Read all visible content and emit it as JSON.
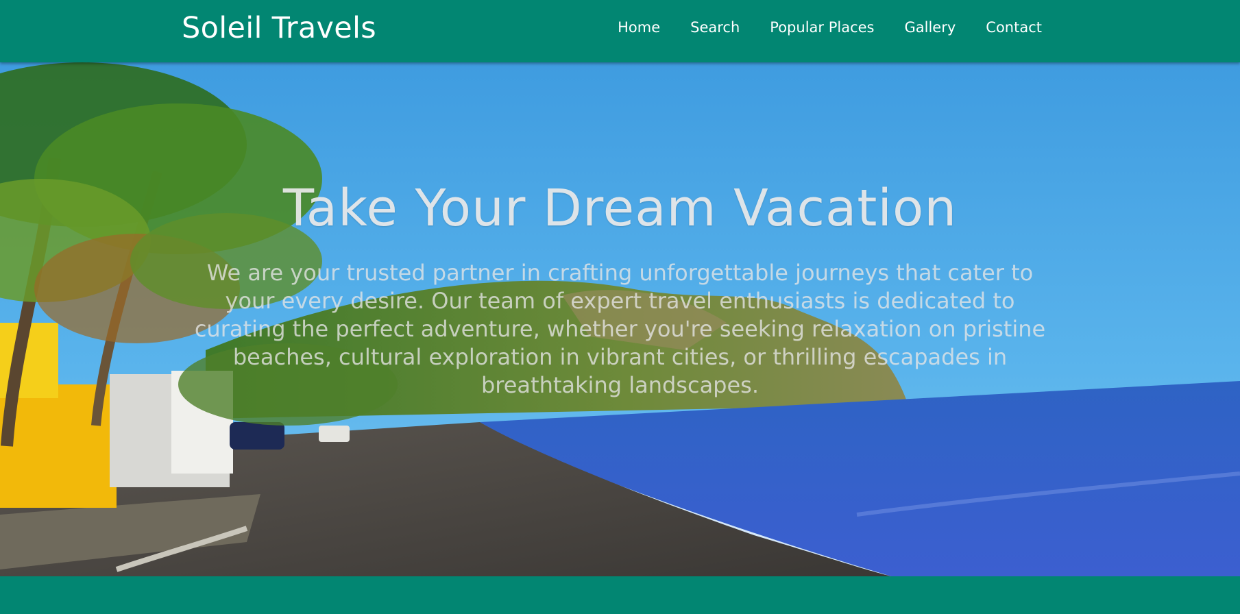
{
  "brand": {
    "name": "Soleil Travels"
  },
  "nav": {
    "items": [
      {
        "label": "Home"
      },
      {
        "label": "Search"
      },
      {
        "label": "Popular Places"
      },
      {
        "label": "Gallery"
      },
      {
        "label": "Contact"
      }
    ]
  },
  "hero": {
    "title": "Take Your Dream Vacation",
    "description": "We are your trusted partner in crafting unforgettable journeys that cater to your every desire. Our team of expert travel enthusiasts is dedicated to curating the perfect adventure, whether you're seeking relaxation on pristine beaches, cultural exploration in vibrant cities, or thrilling escapades in breathtaking landscapes."
  },
  "colors": {
    "primary": "#028672",
    "text": "#ffffff"
  }
}
